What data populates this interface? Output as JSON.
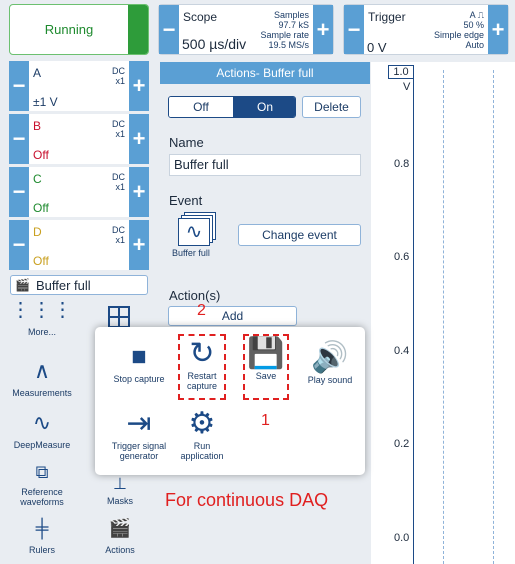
{
  "run_button": {
    "label": "Running"
  },
  "scope": {
    "title": "Scope",
    "timebase": "500 µs/div",
    "samples_label": "Samples",
    "samples_value": "97.7 kS",
    "rate_label": "Sample rate",
    "rate_value": "19.5 MS/s"
  },
  "trigger": {
    "title": "Trigger",
    "level": "0 V",
    "channel": "A",
    "percent": "50 %",
    "type": "Simple edge",
    "mode": "Auto"
  },
  "channels": [
    {
      "name": "A",
      "coupling": "DC",
      "probe": "x1",
      "range": "±1 V",
      "color": "#1c3c66"
    },
    {
      "name": "B",
      "coupling": "DC",
      "probe": "x1",
      "range": "Off",
      "color": "#c8102e"
    },
    {
      "name": "C",
      "coupling": "DC",
      "probe": "x1",
      "range": "Off",
      "color": "#1e8a2e"
    },
    {
      "name": "D",
      "coupling": "DC",
      "probe": "x1",
      "range": "Off",
      "color": "#c9a020"
    }
  ],
  "buffer_tag": {
    "label": "Buffer full"
  },
  "sidebar": {
    "more": "More...",
    "measurements": "Measurements",
    "deepmeasure": "DeepMeasure",
    "reference": "Reference waveforms",
    "masks": "Masks",
    "rulers": "Rulers",
    "actions": "Actions"
  },
  "actions_panel": {
    "title": "Actions- Buffer full",
    "off": "Off",
    "on": "On",
    "delete": "Delete",
    "name_label": "Name",
    "name_value": "Buffer full",
    "event_label": "Event",
    "event_icon_label": "Buffer full",
    "change_event": "Change event",
    "actions_label": "Action(s)",
    "add": "Add"
  },
  "popup": {
    "stop_capture": "Stop capture",
    "restart_capture": "Restart capture",
    "save": "Save",
    "play_sound": "Play sound",
    "trigger_gen": "Trigger signal generator",
    "run_app": "Run application"
  },
  "annotations": {
    "one": "1",
    "two": "2",
    "note": "For continuous DAQ"
  },
  "graph": {
    "unit": "V",
    "top": "1.0",
    "ticks": [
      "0.8",
      "0.6",
      "0.4",
      "0.2",
      "0.0"
    ]
  }
}
